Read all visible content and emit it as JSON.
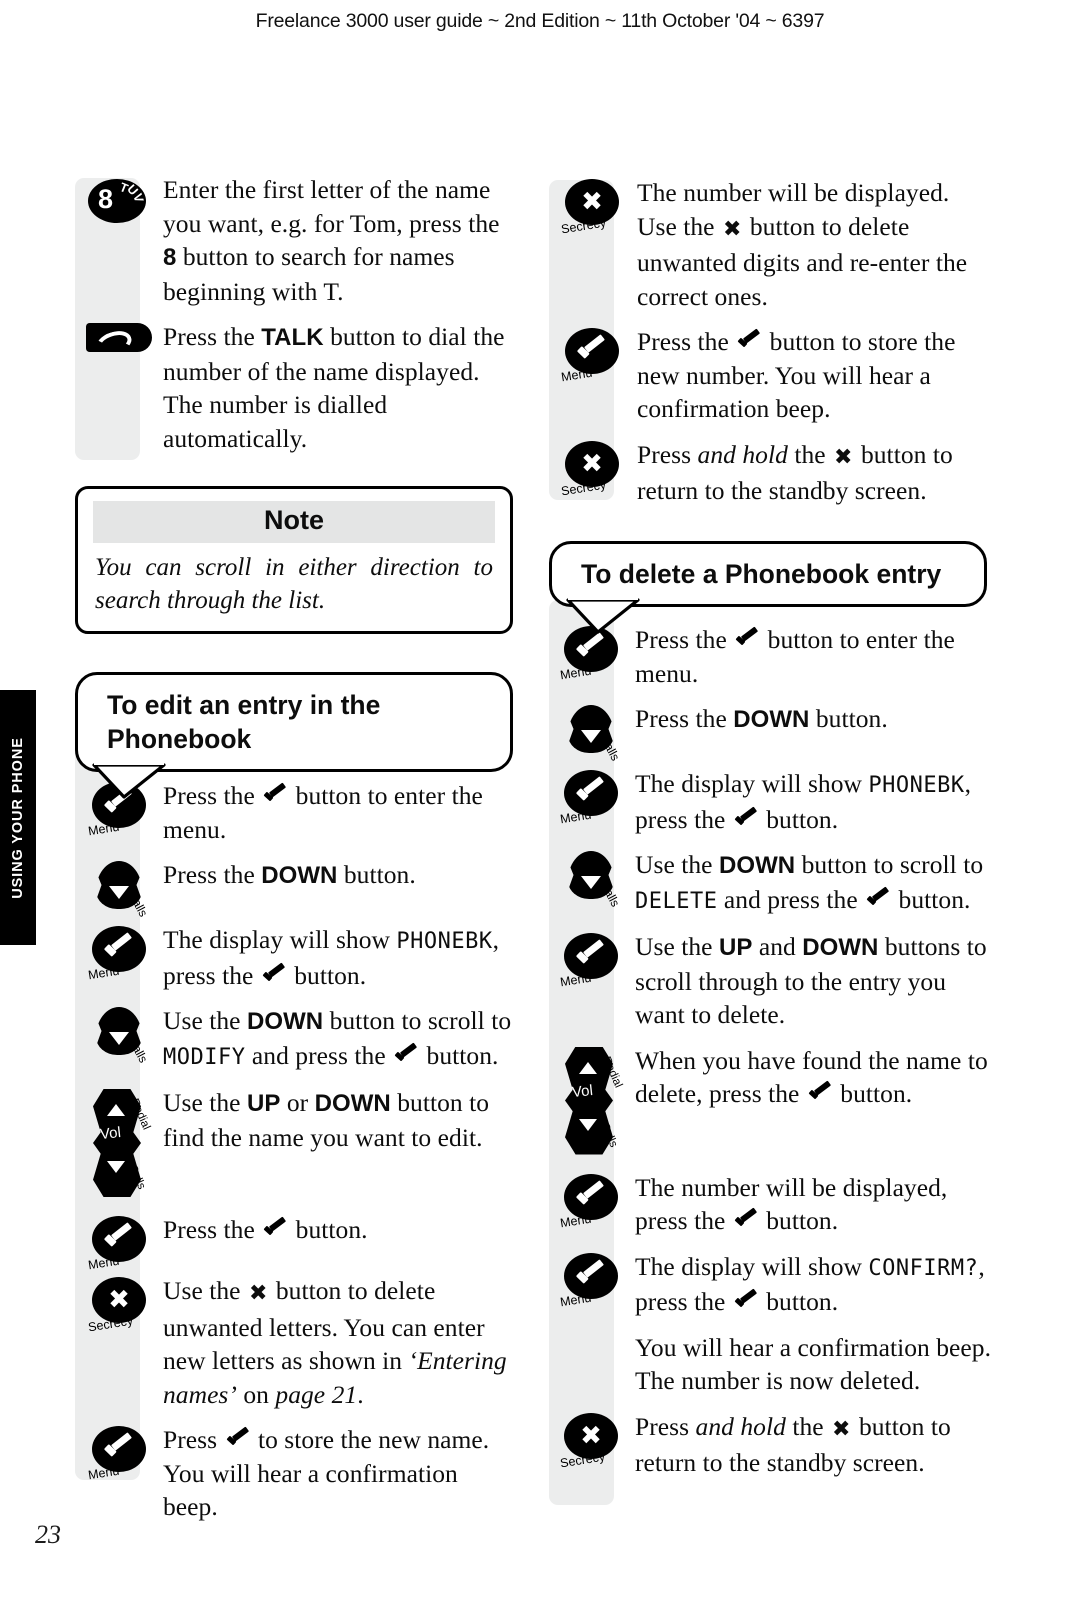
{
  "header": {
    "running_head": "Freelance 3000 user guide ~ 2nd Edition ~ 11th October '04 ~ 6397"
  },
  "side_tab": {
    "label": "USING YOUR PHONE"
  },
  "folio": {
    "page_number": "23"
  },
  "icons": {
    "menu_caption": "Menu",
    "calls_caption": "Calls",
    "secrecy_caption": "Secrecy",
    "redial_caption": "Redial",
    "vol_caption": "Vol",
    "key8_digit": "8",
    "key8_letters": [
      "T",
      "U",
      "V"
    ]
  },
  "left_column": {
    "steps_top": [
      {
        "icon": "key-8-tuv",
        "parts": [
          {
            "t": "Enter the first letter of the name you want, e.g. for Tom, press the ",
            "s": "plain"
          },
          {
            "t": "8",
            "s": "bold"
          },
          {
            "t": " button to search for names beginning with T.",
            "s": "plain"
          }
        ]
      },
      {
        "icon": "talk-key",
        "parts": [
          {
            "t": "Press the ",
            "s": "plain"
          },
          {
            "t": "TALK",
            "s": "bold"
          },
          {
            "t": " button to dial the number of the name displayed. The number is dialled automatically.",
            "s": "plain"
          }
        ]
      }
    ],
    "note": {
      "title": "Note",
      "body": "You can scroll in either direction to search through the list."
    },
    "callout_heading": "To edit an entry in the Phonebook",
    "steps_bottom": [
      {
        "icon": "menu-tick-key",
        "parts": [
          {
            "t": "Press the ",
            "s": "plain"
          },
          {
            "t": "",
            "s": "tick"
          },
          {
            "t": " button to enter the menu.",
            "s": "plain"
          }
        ]
      },
      {
        "icon": "down-calls-key",
        "parts": [
          {
            "t": "Press the ",
            "s": "plain"
          },
          {
            "t": "DOWN",
            "s": "bold"
          },
          {
            "t": " button.",
            "s": "plain"
          }
        ]
      },
      {
        "icon": "menu-tick-key",
        "parts": [
          {
            "t": "The display will show ",
            "s": "plain"
          },
          {
            "t": "PHONEBK",
            "s": "lcd"
          },
          {
            "t": ", press the ",
            "s": "plain"
          },
          {
            "t": "",
            "s": "tick"
          },
          {
            "t": " button.",
            "s": "plain"
          }
        ]
      },
      {
        "icon": "down-calls-key",
        "parts": [
          {
            "t": "Use the ",
            "s": "plain"
          },
          {
            "t": "DOWN",
            "s": "bold"
          },
          {
            "t": " button to scroll to ",
            "s": "plain"
          },
          {
            "t": "MODIFY",
            "s": "lcd"
          },
          {
            "t": " and press the ",
            "s": "plain"
          },
          {
            "t": "",
            "s": "tick"
          },
          {
            "t": " button.",
            "s": "plain"
          }
        ]
      },
      {
        "icon": "updown-rocker-key",
        "parts": [
          {
            "t": "Use the ",
            "s": "plain"
          },
          {
            "t": "UP",
            "s": "bold"
          },
          {
            "t": " or ",
            "s": "plain"
          },
          {
            "t": "DOWN",
            "s": "bold"
          },
          {
            "t": " button to find the name you want to edit.",
            "s": "plain"
          }
        ]
      },
      {
        "icon": "menu-tick-key",
        "parts": [
          {
            "t": "Press the ",
            "s": "plain"
          },
          {
            "t": "",
            "s": "tick"
          },
          {
            "t": " button.",
            "s": "plain"
          }
        ]
      },
      {
        "icon": "secrecy-x-key",
        "parts": [
          {
            "t": "Use the ",
            "s": "plain"
          },
          {
            "t": "",
            "s": "xmark"
          },
          {
            "t": " button to delete unwanted letters. You can enter new letters as shown in ",
            "s": "plain"
          },
          {
            "t": "‘Entering names’",
            "s": "italic"
          },
          {
            "t": " on ",
            "s": "plain"
          },
          {
            "t": "page 21",
            "s": "italic"
          },
          {
            "t": ".",
            "s": "plain"
          }
        ]
      },
      {
        "icon": "menu-tick-key",
        "parts": [
          {
            "t": "Press ",
            "s": "plain"
          },
          {
            "t": "",
            "s": "tick"
          },
          {
            "t": " to store the new name. You will hear a confirmation beep.",
            "s": "plain"
          }
        ]
      }
    ]
  },
  "right_column": {
    "steps_top": [
      {
        "icon": "secrecy-x-key",
        "parts": [
          {
            "t": "The number will be displayed. Use the ",
            "s": "plain"
          },
          {
            "t": "",
            "s": "xmark"
          },
          {
            "t": " button to delete unwanted digits and re-enter the correct ones.",
            "s": "plain"
          }
        ]
      },
      {
        "icon": "menu-tick-key",
        "parts": [
          {
            "t": "Press the ",
            "s": "plain"
          },
          {
            "t": "",
            "s": "tick"
          },
          {
            "t": " button to store the new number. You will hear a confirmation beep.",
            "s": "plain"
          }
        ]
      },
      {
        "icon": "secrecy-x-key",
        "parts": [
          {
            "t": "Press ",
            "s": "plain"
          },
          {
            "t": "and hold",
            "s": "italic"
          },
          {
            "t": " the ",
            "s": "plain"
          },
          {
            "t": "",
            "s": "xmark"
          },
          {
            "t": " button to return to the standby screen.",
            "s": "plain"
          }
        ]
      }
    ],
    "callout_heading": "To delete a Phonebook entry",
    "steps_bottom": [
      {
        "icon": "menu-tick-key",
        "parts": [
          {
            "t": "Press the ",
            "s": "plain"
          },
          {
            "t": "",
            "s": "tick"
          },
          {
            "t": " button to enter the menu.",
            "s": "plain"
          }
        ]
      },
      {
        "icon": "down-calls-key",
        "parts": [
          {
            "t": "Press the ",
            "s": "plain"
          },
          {
            "t": "DOWN",
            "s": "bold"
          },
          {
            "t": " button.",
            "s": "plain"
          }
        ]
      },
      {
        "icon": "menu-tick-key",
        "parts": [
          {
            "t": "The display will show ",
            "s": "plain"
          },
          {
            "t": "PHONEBK",
            "s": "lcd"
          },
          {
            "t": ", press the ",
            "s": "plain"
          },
          {
            "t": "",
            "s": "tick"
          },
          {
            "t": " button.",
            "s": "plain"
          }
        ]
      },
      {
        "icon": "down-calls-key",
        "parts": [
          {
            "t": "Use the ",
            "s": "plain"
          },
          {
            "t": "DOWN",
            "s": "bold"
          },
          {
            "t": " button to scroll to ",
            "s": "plain"
          },
          {
            "t": "DELETE",
            "s": "lcd"
          },
          {
            "t": " and press the ",
            "s": "plain"
          },
          {
            "t": "",
            "s": "tick"
          },
          {
            "t": " button.",
            "s": "plain"
          }
        ]
      },
      {
        "icon": "menu-tick-key",
        "parts": [
          {
            "t": "Use the ",
            "s": "plain"
          },
          {
            "t": "UP",
            "s": "bold"
          },
          {
            "t": " and ",
            "s": "plain"
          },
          {
            "t": "DOWN",
            "s": "bold"
          },
          {
            "t": " buttons to scroll through to the entry you want to delete.",
            "s": "plain"
          }
        ]
      },
      {
        "icon": "updown-rocker-key",
        "parts": [
          {
            "t": "When you have found the name to delete, press the ",
            "s": "plain"
          },
          {
            "t": "",
            "s": "tick"
          },
          {
            "t": " button.",
            "s": "plain"
          }
        ]
      },
      {
        "icon": "menu-tick-key",
        "parts": [
          {
            "t": "The number will be displayed, press the ",
            "s": "plain"
          },
          {
            "t": "",
            "s": "tick"
          },
          {
            "t": " button.",
            "s": "plain"
          }
        ]
      },
      {
        "icon": "menu-tick-key",
        "parts": [
          {
            "t": "The display will show ",
            "s": "plain"
          },
          {
            "t": "CONFIRM?",
            "s": "lcd"
          },
          {
            "t": ", press the ",
            "s": "plain"
          },
          {
            "t": "",
            "s": "tick"
          },
          {
            "t": " button.",
            "s": "plain"
          }
        ]
      },
      {
        "icon": "none",
        "parts": [
          {
            "t": "You will hear a confirmation beep. The number is now deleted.",
            "s": "plain"
          }
        ]
      },
      {
        "icon": "secrecy-x-key",
        "parts": [
          {
            "t": "Press ",
            "s": "plain"
          },
          {
            "t": "and hold",
            "s": "italic"
          },
          {
            "t": " the ",
            "s": "plain"
          },
          {
            "t": "",
            "s": "xmark"
          },
          {
            "t": " button to return to the standby screen.",
            "s": "plain"
          }
        ]
      }
    ]
  }
}
